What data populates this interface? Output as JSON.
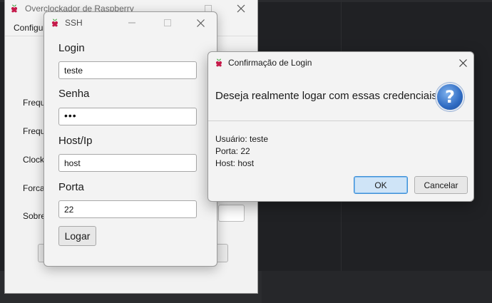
{
  "main_window": {
    "title": "Overclockador de Raspberry",
    "menu": [
      "Configu"
    ],
    "labels": [
      "Frequ",
      "Frequ",
      "Clock",
      "Forcar",
      "Sobre"
    ]
  },
  "ssh_window": {
    "title": "SSH",
    "login_label": "Login",
    "login_value": "teste",
    "senha_label": "Senha",
    "senha_value": "•••",
    "host_label": "Host/Ip",
    "host_value": "host",
    "porta_label": "Porta",
    "porta_value": "22",
    "logar_button": "Logar"
  },
  "dialog": {
    "title": "Confirmação de Login",
    "question": "Deseja realmente logar com essas credenciais?",
    "details": [
      "Usuário: teste",
      "Porta: 22",
      "Host: host"
    ],
    "ok_button": "OK",
    "cancel_button": "Cancelar"
  },
  "icons": {
    "app": "raspberry-icon",
    "question": "question-icon"
  },
  "colors": {
    "desktop": "#202124",
    "window_bg": "#f3f3f3",
    "ok_accent": "#3e8fd6",
    "question_icon": "#2f6bc2"
  }
}
